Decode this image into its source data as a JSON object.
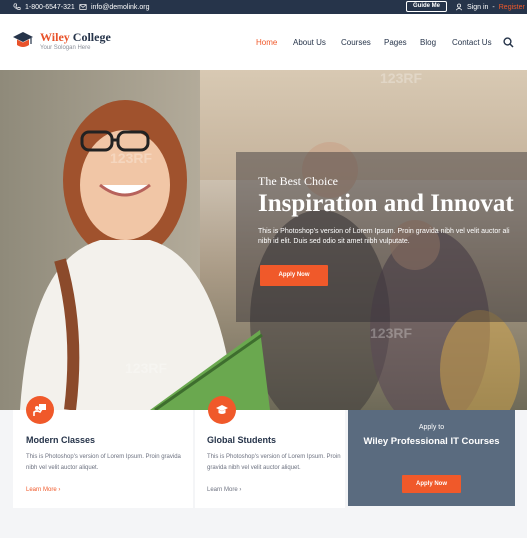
{
  "topbar": {
    "phone": "1-800-6547-321",
    "email": "info@demolink.org",
    "guide_label": "Guide Me",
    "sign_in": "Sign in",
    "separator": "-",
    "register": "Register"
  },
  "brand": {
    "name_part1": "Wiley",
    "name_part2": "College",
    "slogan": "Your Sologan Here"
  },
  "nav": {
    "items": [
      "Home",
      "About Us",
      "Courses",
      "Pages",
      "Blog",
      "Contact Us"
    ],
    "active": "Home"
  },
  "hero": {
    "subtitle": "The Best Choice",
    "title": "Inspiration and Innovat",
    "description": "This is Photoshop's version of Lorem Ipsum. Proin gravida nibh vel velit auctor ali nibh id elit. Duis sed odio sit amet nibh vulputate.",
    "button": "Apply Now",
    "watermark": "123RF"
  },
  "cards": [
    {
      "title": "Modern Classes",
      "description": "This is Photoshop's version of Lorem Ipsum. Proin gravida nibh vel velit auctor aliquet.",
      "link": "Learn More",
      "icon": "teacher-icon"
    },
    {
      "title": "Global Students",
      "description": "This is Photoshop's version of Lorem Ipsum. Proin gravida nibh vel velit auctor aliquet.",
      "link": "Learn More",
      "icon": "graduation-cap-icon"
    }
  ],
  "apply_card": {
    "apply_to": "Apply to",
    "program": "Wiley Professional IT Courses",
    "button": "Apply Now"
  },
  "colors": {
    "accent": "#f0592a",
    "navy": "#26344a",
    "slate": "#5a6b7f"
  }
}
